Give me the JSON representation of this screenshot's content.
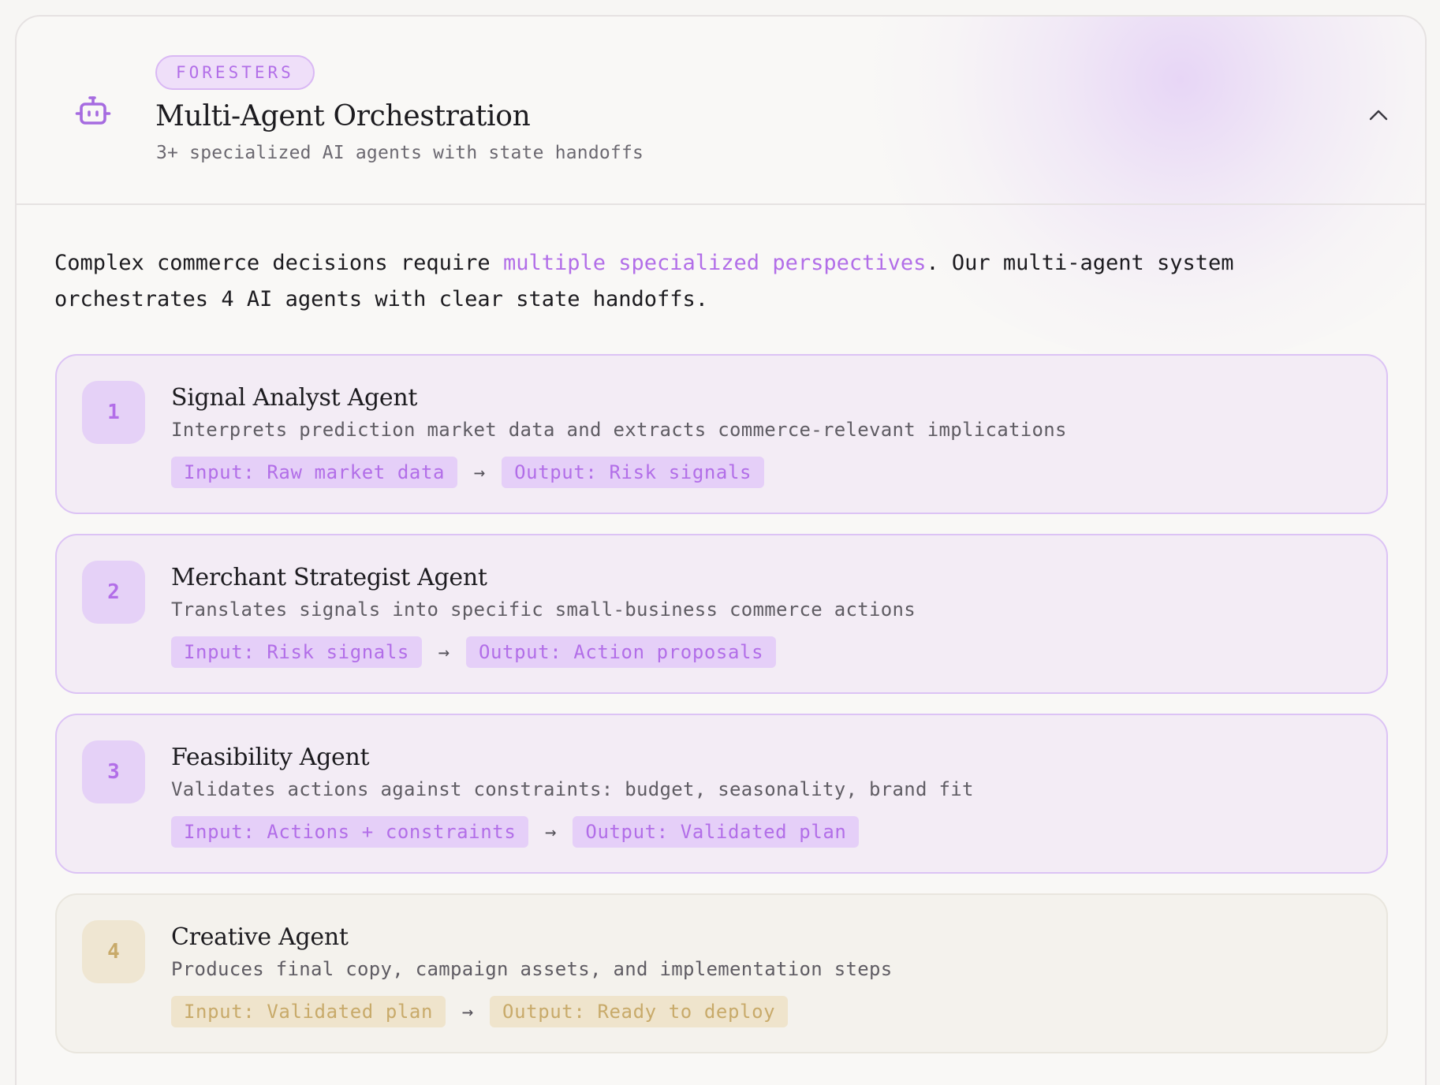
{
  "header": {
    "badge": "FORESTERS",
    "title": "Multi-Agent Orchestration",
    "subtitle": "3+ specialized AI agents with state handoffs",
    "icon": "robot-icon",
    "collapse_icon": "chevron-up-icon"
  },
  "intro": {
    "before": "Complex commerce decisions require ",
    "highlight": "multiple specialized perspectives",
    "after": ". Our multi-agent system orchestrates 4 AI agents with clear state handoffs."
  },
  "agents": [
    {
      "number": "1",
      "name": "Signal Analyst Agent",
      "description": "Interprets prediction market data and extracts commerce-relevant implications",
      "input": "Input: Raw market data",
      "arrow": "→",
      "output": "Output: Risk signals"
    },
    {
      "number": "2",
      "name": "Merchant Strategist Agent",
      "description": "Translates signals into specific small-business commerce actions",
      "input": "Input: Risk signals",
      "arrow": "→",
      "output": "Output: Action proposals"
    },
    {
      "number": "3",
      "name": "Feasibility Agent",
      "description": "Validates actions against constraints: budget, seasonality, brand fit",
      "input": "Input: Actions + constraints",
      "arrow": "→",
      "output": "Output: Validated plan"
    },
    {
      "number": "4",
      "name": "Creative Agent",
      "description": "Produces final copy, campaign assets, and implementation steps",
      "input": "Input: Validated plan",
      "arrow": "→",
      "output": "Output: Ready to deploy"
    }
  ],
  "colors": {
    "accent": "#b26ee8",
    "accent_soft": "#e5cff8",
    "gold": "#c8aa6a",
    "gold_soft": "#efe4cc"
  }
}
